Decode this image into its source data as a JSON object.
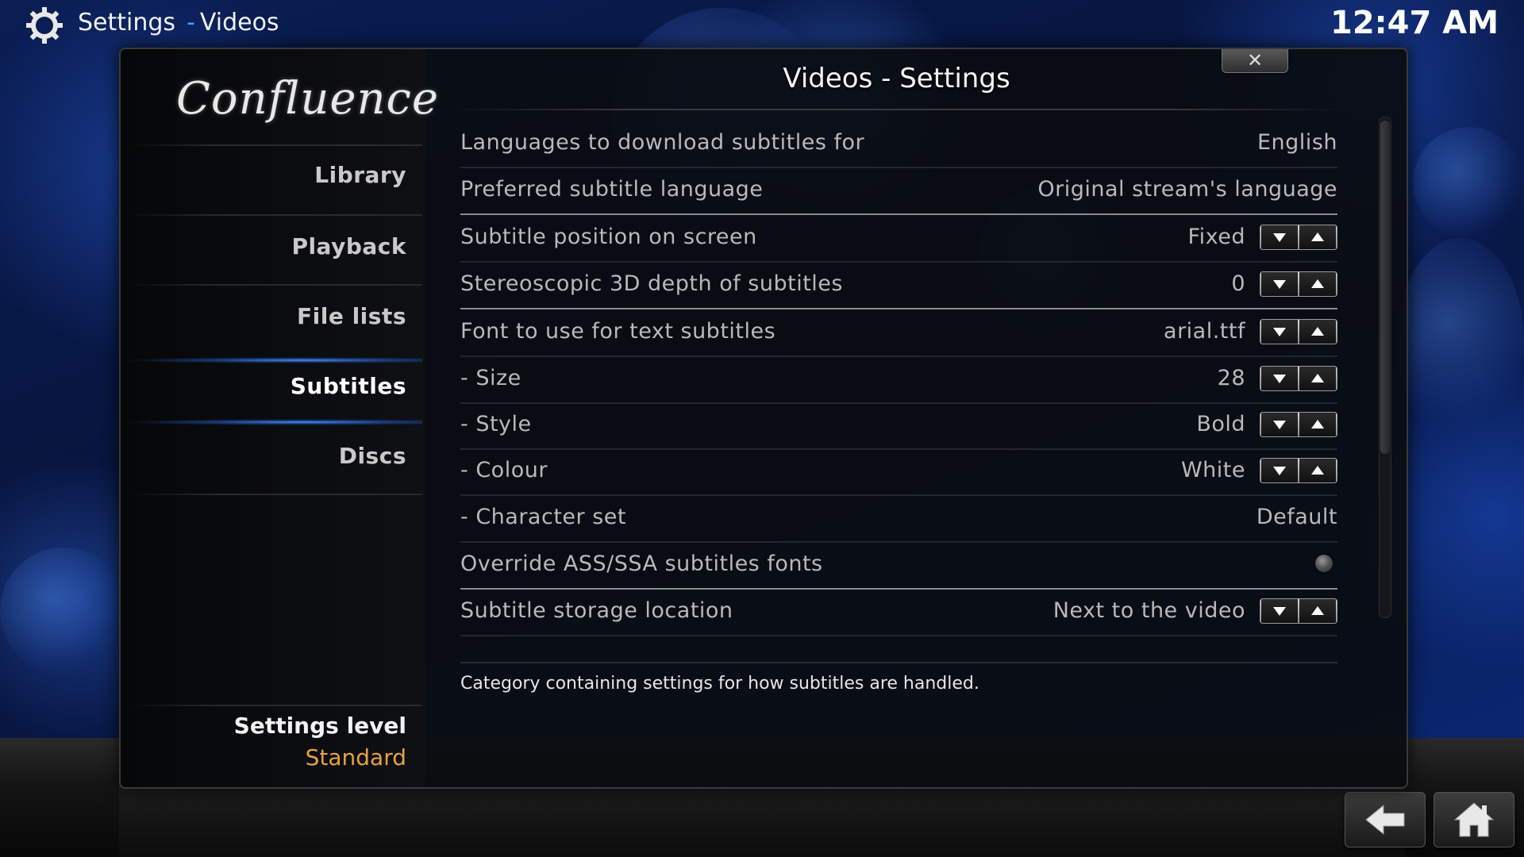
{
  "header": {
    "section": "Settings",
    "separator": "-",
    "subsection": "Videos",
    "clock": "12:47 AM"
  },
  "sidebar": {
    "logo": "Confluence",
    "items": [
      {
        "label": "Library",
        "active": false
      },
      {
        "label": "Playback",
        "active": false
      },
      {
        "label": "File lists",
        "active": false
      },
      {
        "label": "Subtitles",
        "active": true
      },
      {
        "label": "Discs",
        "active": false
      }
    ],
    "settings_level_label": "Settings level",
    "settings_level_value": "Standard"
  },
  "dialog": {
    "title": "Videos - Settings",
    "close_icon": "close-icon"
  },
  "settings": [
    {
      "label": "Languages to download subtitles for",
      "value": "English",
      "control": "none"
    },
    {
      "label": "Preferred subtitle language",
      "value": "Original stream's language",
      "control": "none"
    },
    {
      "label": "Subtitle position on screen",
      "value": "Fixed",
      "control": "spinner"
    },
    {
      "label": "Stereoscopic 3D depth of subtitles",
      "value": "0",
      "control": "spinner"
    },
    {
      "label": "Font to use for text subtitles",
      "value": "arial.ttf",
      "control": "spinner"
    },
    {
      "label": "- Size",
      "value": "28",
      "control": "spinner"
    },
    {
      "label": "- Style",
      "value": "Bold",
      "control": "spinner"
    },
    {
      "label": "- Colour",
      "value": "White",
      "control": "spinner"
    },
    {
      "label": "- Character set",
      "value": "Default",
      "control": "none"
    },
    {
      "label": "Override ASS/SSA subtitles fonts",
      "value": "",
      "control": "radio",
      "checked": false
    },
    {
      "label": "Subtitle storage location",
      "value": "Next to the video",
      "control": "spinner"
    }
  ],
  "description": "Category containing settings for how subtitles are handled.",
  "footer": {
    "back_icon": "back-arrow-icon",
    "home_icon": "home-icon"
  },
  "colors": {
    "accent": "#4aa3ff",
    "settings_level_value": "#e8a040",
    "text_dim": "#b9b9b9"
  }
}
